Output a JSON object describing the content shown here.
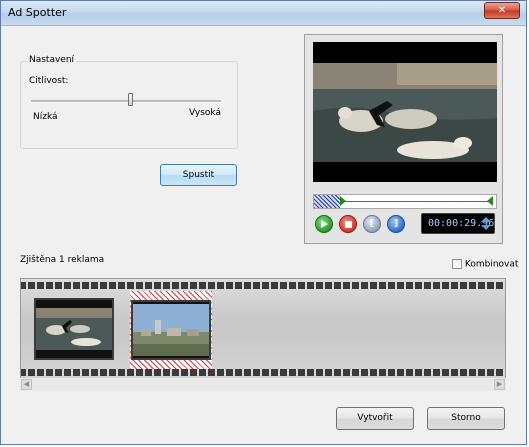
{
  "window": {
    "title": "Ad Spotter",
    "close_glyph": "✕"
  },
  "settings": {
    "group_label": "Nastavení",
    "sensitivity_label": "Citlivost:",
    "low_label": "Nízká",
    "high_label": "Vysoká",
    "sensitivity_value": 0.52
  },
  "start_button": "Spustit",
  "preview": {
    "timecode": "00:00:29.96",
    "controls": [
      {
        "icon": "play-icon",
        "color": "#2e9a2e"
      },
      {
        "icon": "stop-icon",
        "color": "#d23a2a"
      },
      {
        "icon": "mark-in-icon",
        "color": "#8fa0b8"
      },
      {
        "icon": "mark-out-icon",
        "color": "#2d6fd0"
      }
    ]
  },
  "detected_label": "Zjištěna 1 reklama",
  "combine_label": "Kombinovat",
  "buttons": {
    "create": "Vytvořit",
    "cancel": "Storno"
  },
  "colors": {
    "accent_blue": "#2d6fd0",
    "selection_red": "#d33333",
    "title_bar": "#c3d8ee"
  }
}
